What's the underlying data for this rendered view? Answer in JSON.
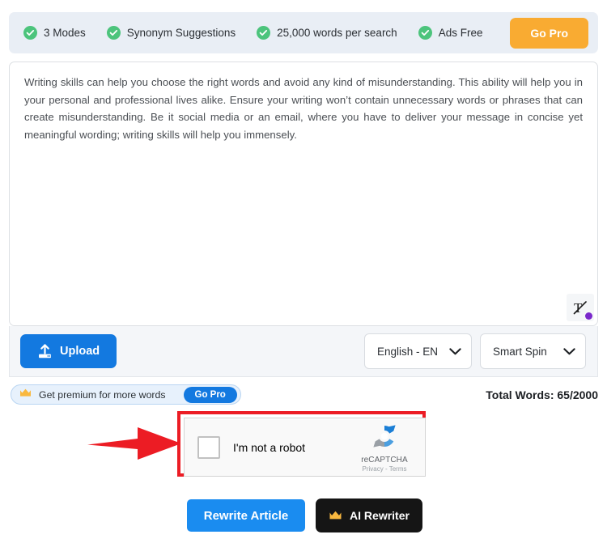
{
  "feature_bar": {
    "features": [
      {
        "icon": "check-circle-icon",
        "label": "3 Modes"
      },
      {
        "icon": "check-circle-icon",
        "label": "Synonym Suggestions"
      },
      {
        "icon": "check-circle-icon",
        "label": "25,000 words per search"
      },
      {
        "icon": "check-circle-icon",
        "label": "Ads Free"
      }
    ],
    "go_pro_label": "Go Pro",
    "go_pro_color": "#f9ab32",
    "background_color": "#e9eef5"
  },
  "editor": {
    "content": "Writing skills can help you choose the right words and avoid any kind of misunderstanding. This ability will help you in your personal and professional lives alike. Ensure your writing won’t contain unnecessary words or phrases that can create misunderstanding. Be it social media or an email, where you have to deliver your message in concise yet meaningful wording; writing skills will help you immensely.",
    "placeholder": "Enter your text here",
    "assistant_icon": "grammarly-icon",
    "assistant_dot_color": "#7a28cb"
  },
  "toolbar": {
    "upload_label": "Upload",
    "upload_icon": "upload-icon",
    "upload_color": "#1379e0",
    "language_select": {
      "value": "English - EN",
      "icon": "chevron-down-icon"
    },
    "mode_select": {
      "value": "Smart Spin",
      "icon": "chevron-down-icon"
    }
  },
  "premium": {
    "icon": "crown-icon",
    "text": "Get premium for more words",
    "go_pro_label": "Go Pro",
    "go_pro_color": "#1379e0"
  },
  "word_count": {
    "label": "Total Words: 65/2000",
    "current": 65,
    "maximum": 2000
  },
  "captcha": {
    "checkbox_checked": false,
    "label": "I'm not a robot",
    "brand": "reCAPTCHA",
    "links": "Privacy - Terms",
    "logo_icon": "recaptcha-logo-icon",
    "highlight_color": "#ec1c24"
  },
  "annotation": {
    "arrow_icon": "red-arrow-icon",
    "arrow_color": "#ec1c24",
    "direction": "right"
  },
  "actions": {
    "rewrite_label": "Rewrite Article",
    "rewrite_color": "#1a8cf0",
    "ai_rewriter_label": "AI Rewriter",
    "ai_rewriter_icon": "crown-icon",
    "ai_rewriter_color": "#151515"
  }
}
